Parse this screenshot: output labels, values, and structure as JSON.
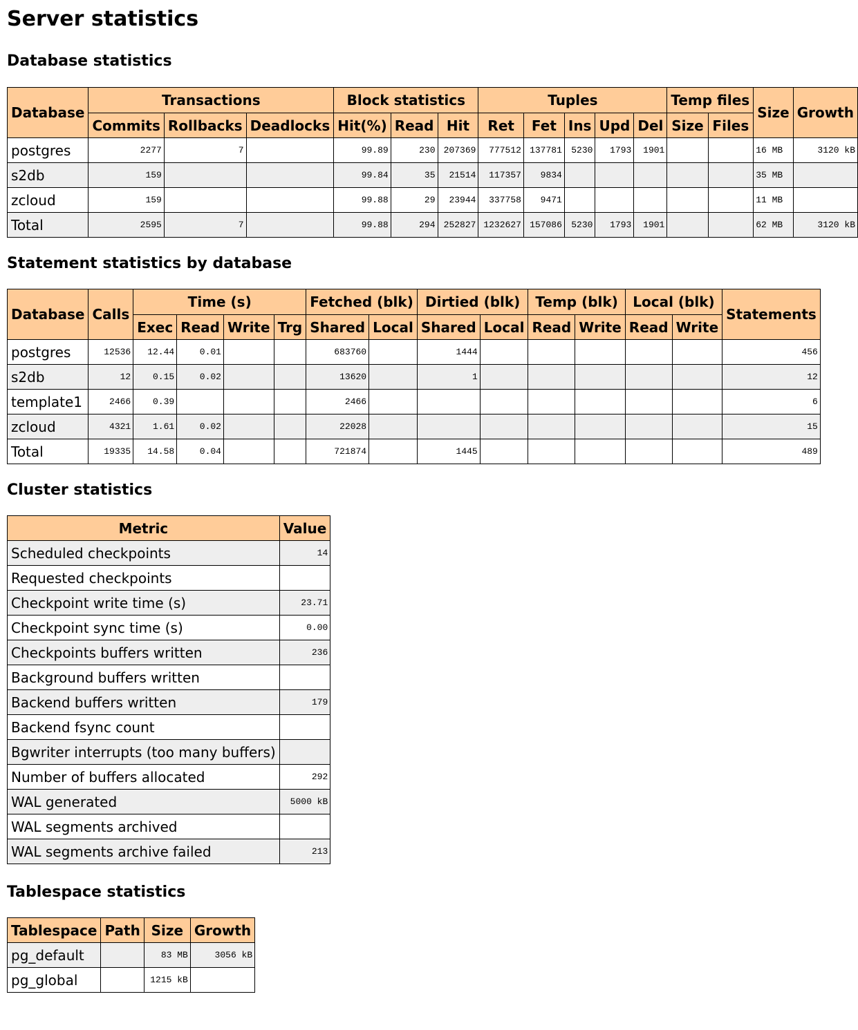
{
  "page": {
    "title": "Server statistics"
  },
  "database_statistics": {
    "heading": "Database statistics",
    "header": {
      "database": "Database",
      "groups": {
        "transactions": "Transactions",
        "block_statistics": "Block statistics",
        "tuples": "Tuples",
        "temp_files": "Temp files"
      },
      "size": "Size",
      "growth": "Growth",
      "columns": {
        "commits": "Commits",
        "rollbacks": "Rollbacks",
        "deadlocks": "Deadlocks",
        "hit_pct": "Hit(%)",
        "read": "Read",
        "hit": "Hit",
        "ret": "Ret",
        "fet": "Fet",
        "ins": "Ins",
        "upd": "Upd",
        "del": "Del",
        "temp_size": "Size",
        "temp_files": "Files"
      }
    },
    "rows": [
      {
        "database": "postgres",
        "commits": "2277",
        "rollbacks": "7",
        "deadlocks": "",
        "hit_pct": "99.89",
        "read": "230",
        "hit": "207369",
        "ret": "777512",
        "fet": "137781",
        "ins": "5230",
        "upd": "1793",
        "del": "1901",
        "temp_size": "",
        "temp_files": "",
        "size": "16 MB",
        "growth": "3120 kB"
      },
      {
        "database": "s2db",
        "commits": "159",
        "rollbacks": "",
        "deadlocks": "",
        "hit_pct": "99.84",
        "read": "35",
        "hit": "21514",
        "ret": "117357",
        "fet": "9834",
        "ins": "",
        "upd": "",
        "del": "",
        "temp_size": "",
        "temp_files": "",
        "size": "35 MB",
        "growth": ""
      },
      {
        "database": "zcloud",
        "commits": "159",
        "rollbacks": "",
        "deadlocks": "",
        "hit_pct": "99.88",
        "read": "29",
        "hit": "23944",
        "ret": "337758",
        "fet": "9471",
        "ins": "",
        "upd": "",
        "del": "",
        "temp_size": "",
        "temp_files": "",
        "size": "11 MB",
        "growth": ""
      },
      {
        "database": "Total",
        "commits": "2595",
        "rollbacks": "7",
        "deadlocks": "",
        "hit_pct": "99.88",
        "read": "294",
        "hit": "252827",
        "ret": "1232627",
        "fet": "157086",
        "ins": "5230",
        "upd": "1793",
        "del": "1901",
        "temp_size": "",
        "temp_files": "",
        "size": "62 MB",
        "growth": "3120 kB"
      }
    ]
  },
  "statement_statistics": {
    "heading": "Statement statistics by database",
    "header": {
      "database": "Database",
      "calls": "Calls",
      "groups": {
        "time": "Time (s)",
        "fetched": "Fetched (blk)",
        "dirtied": "Dirtied (blk)",
        "temp": "Temp (blk)",
        "local": "Local (blk)"
      },
      "statements": "Statements",
      "columns": {
        "exec": "Exec",
        "read": "Read",
        "write": "Write",
        "trg": "Trg",
        "fetched_shared": "Shared",
        "fetched_local": "Local",
        "dirtied_shared": "Shared",
        "dirtied_local": "Local",
        "temp_read": "Read",
        "temp_write": "Write",
        "local_read": "Read",
        "local_write": "Write"
      }
    },
    "rows": [
      {
        "database": "postgres",
        "calls": "12536",
        "exec": "12.44",
        "read": "0.01",
        "write": "",
        "trg": "",
        "fetched_shared": "683760",
        "fetched_local": "",
        "dirtied_shared": "1444",
        "dirtied_local": "",
        "temp_read": "",
        "temp_write": "",
        "local_read": "",
        "local_write": "",
        "statements": "456"
      },
      {
        "database": "s2db",
        "calls": "12",
        "exec": "0.15",
        "read": "0.02",
        "write": "",
        "trg": "",
        "fetched_shared": "13620",
        "fetched_local": "",
        "dirtied_shared": "1",
        "dirtied_local": "",
        "temp_read": "",
        "temp_write": "",
        "local_read": "",
        "local_write": "",
        "statements": "12"
      },
      {
        "database": "template1",
        "calls": "2466",
        "exec": "0.39",
        "read": "",
        "write": "",
        "trg": "",
        "fetched_shared": "2466",
        "fetched_local": "",
        "dirtied_shared": "",
        "dirtied_local": "",
        "temp_read": "",
        "temp_write": "",
        "local_read": "",
        "local_write": "",
        "statements": "6"
      },
      {
        "database": "zcloud",
        "calls": "4321",
        "exec": "1.61",
        "read": "0.02",
        "write": "",
        "trg": "",
        "fetched_shared": "22028",
        "fetched_local": "",
        "dirtied_shared": "",
        "dirtied_local": "",
        "temp_read": "",
        "temp_write": "",
        "local_read": "",
        "local_write": "",
        "statements": "15"
      },
      {
        "database": "Total",
        "calls": "19335",
        "exec": "14.58",
        "read": "0.04",
        "write": "",
        "trg": "",
        "fetched_shared": "721874",
        "fetched_local": "",
        "dirtied_shared": "1445",
        "dirtied_local": "",
        "temp_read": "",
        "temp_write": "",
        "local_read": "",
        "local_write": "",
        "statements": "489"
      }
    ]
  },
  "cluster_statistics": {
    "heading": "Cluster statistics",
    "header": {
      "metric": "Metric",
      "value": "Value"
    },
    "rows": [
      {
        "metric": "Scheduled checkpoints",
        "value": "14"
      },
      {
        "metric": "Requested checkpoints",
        "value": ""
      },
      {
        "metric": "Checkpoint write time (s)",
        "value": "23.71"
      },
      {
        "metric": "Checkpoint sync time (s)",
        "value": "0.00"
      },
      {
        "metric": "Checkpoints buffers written",
        "value": "236"
      },
      {
        "metric": "Background buffers written",
        "value": ""
      },
      {
        "metric": "Backend buffers written",
        "value": "179"
      },
      {
        "metric": "Backend fsync count",
        "value": ""
      },
      {
        "metric": "Bgwriter interrupts (too many buffers)",
        "value": ""
      },
      {
        "metric": "Number of buffers allocated",
        "value": "292"
      },
      {
        "metric": "WAL generated",
        "value": "5000 kB"
      },
      {
        "metric": "WAL segments archived",
        "value": ""
      },
      {
        "metric": "WAL segments archive failed",
        "value": "213"
      }
    ]
  },
  "tablespace_statistics": {
    "heading": "Tablespace statistics",
    "header": {
      "tablespace": "Tablespace",
      "path": "Path",
      "size": "Size",
      "growth": "Growth"
    },
    "rows": [
      {
        "tablespace": "pg_default",
        "path": "",
        "size": "83 MB",
        "growth": "3056 kB"
      },
      {
        "tablespace": "pg_global",
        "path": "",
        "size": "1215 kB",
        "growth": ""
      }
    ]
  }
}
